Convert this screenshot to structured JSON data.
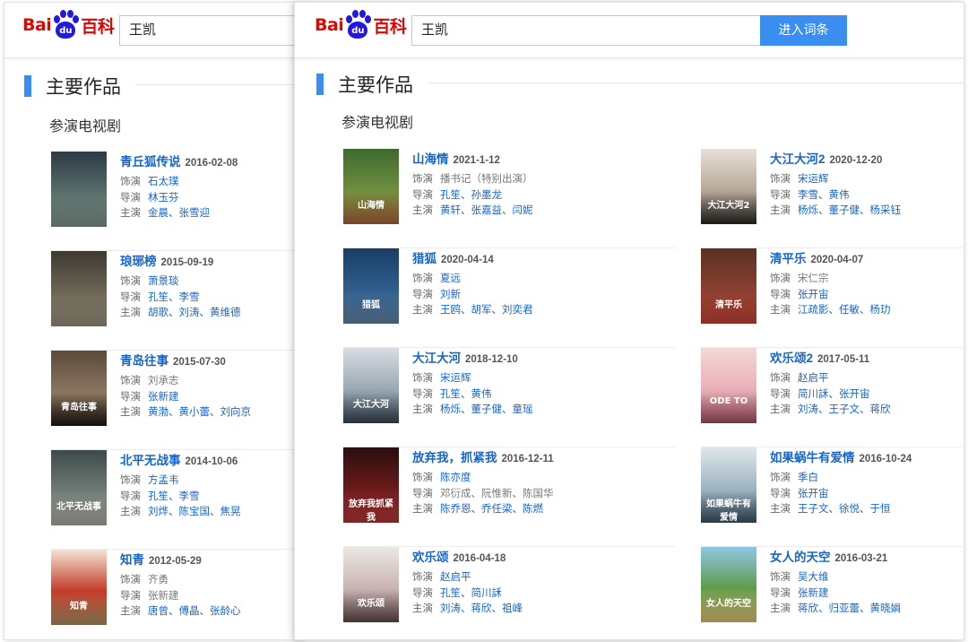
{
  "logo": {
    "bai": "Bai",
    "du": "du",
    "baike": "百科"
  },
  "left_panel": {
    "search_value": "王凯",
    "section_title": "主要作品",
    "sub_title": "参演电视剧",
    "items": [
      {
        "name": "青丘狐传说",
        "date": "2016-02-08",
        "role_label": "饰演",
        "role": "石太璞",
        "director_label": "导演",
        "director": "林玉芬",
        "cast_label": "主演",
        "cast": "金晨、张雪迎",
        "role_gray": false
      },
      {
        "name": "琅琊榜",
        "date": "2015-09-19",
        "role_label": "饰演",
        "role": "萧景琰",
        "director_label": "导演",
        "director": "孔笙、李雪",
        "cast_label": "主演",
        "cast": "胡歌、刘涛、黄维德",
        "role_gray": false
      },
      {
        "name": "青岛往事",
        "date": "2015-07-30",
        "role_label": "饰演",
        "role": "刘承志",
        "director_label": "导演",
        "director": "张新建",
        "cast_label": "主演",
        "cast": "黄渤、黄小蕾、刘向京",
        "role_gray": true
      },
      {
        "name": "北平无战事",
        "date": "2014-10-06",
        "role_label": "饰演",
        "role": "方孟韦",
        "director_label": "导演",
        "director": "孔笙、李雪",
        "cast_label": "主演",
        "cast": "刘烨、陈宝国、焦晃",
        "role_gray": false
      },
      {
        "name": "知青",
        "date": "2012-05-29",
        "role_label": "饰演",
        "role": "齐勇",
        "director_label": "导演",
        "director": "张新建",
        "cast_label": "主演",
        "cast": "唐曾、傅晶、张龄心",
        "role_gray": true,
        "director_gray": true
      }
    ]
  },
  "right_panel": {
    "search_value": "王凯",
    "search_button": "进入词条",
    "section_title": "主要作品",
    "sub_title": "参演电视剧",
    "items_left": [
      {
        "name": "山海情",
        "date": "2021-1-12",
        "role_label": "饰演",
        "role": "播书记（特别出演）",
        "director_label": "导演",
        "director": "孔笙、孙墨龙",
        "cast_label": "主演",
        "cast": "黄轩、张嘉益、闫妮",
        "role_gray": true
      },
      {
        "name": "猎狐",
        "date": "2020-04-14",
        "role_label": "饰演",
        "role": "夏远",
        "director_label": "导演",
        "director": "刘新",
        "cast_label": "主演",
        "cast": "王鸥、胡军、刘奕君",
        "role_gray": false
      },
      {
        "name": "大江大河",
        "date": "2018-12-10",
        "role_label": "饰演",
        "role": "宋运辉",
        "director_label": "导演",
        "director": "孔笙、黄伟",
        "cast_label": "主演",
        "cast": "杨烁、董子健、童瑶",
        "role_gray": false
      },
      {
        "name": "放弃我，抓紧我",
        "date": "2016-12-11",
        "role_label": "饰演",
        "role": "陈亦度",
        "director_label": "导演",
        "director": "邓衍成、阮惟新、陈国华",
        "cast_label": "主演",
        "cast": "陈乔恩、乔任梁、陈燃",
        "role_gray": false,
        "director_gray": true
      },
      {
        "name": "欢乐颂",
        "date": "2016-04-18",
        "role_label": "饰演",
        "role": "赵启平",
        "director_label": "导演",
        "director": "孔笙、简川訸",
        "cast_label": "主演",
        "cast": "刘涛、蒋欣、祖峰",
        "role_gray": false
      }
    ],
    "items_right": [
      {
        "name": "大江大河2",
        "date": "2020-12-20",
        "role_label": "饰演",
        "role": "宋运辉",
        "director_label": "导演",
        "director": "李雪、黄伟",
        "cast_label": "主演",
        "cast": "杨烁、董子健、杨采钰",
        "role_gray": false
      },
      {
        "name": "清平乐",
        "date": "2020-04-07",
        "role_label": "饰演",
        "role": "宋仁宗",
        "director_label": "导演",
        "director": "张开宙",
        "cast_label": "主演",
        "cast": "江疏影、任敏、杨玏",
        "role_gray": true
      },
      {
        "name": "欢乐颂2",
        "date": "2017-05-11",
        "role_label": "饰演",
        "role": "赵启平",
        "director_label": "导演",
        "director": "简川訸、张开宙",
        "cast_label": "主演",
        "cast": "刘涛、王子文、蒋欣",
        "role_gray": false
      },
      {
        "name": "如果蜗牛有爱情",
        "date": "2016-10-24",
        "role_label": "饰演",
        "role": "季白",
        "director_label": "导演",
        "director": "张开宙",
        "cast_label": "主演",
        "cast": "王子文、徐悦、于恒",
        "role_gray": false
      },
      {
        "name": "女人的天空",
        "date": "2016-03-21",
        "role_label": "饰演",
        "role": "吴大维",
        "director_label": "导演",
        "director": "张新建",
        "cast_label": "主演",
        "cast": "蒋欣、归亚蕾、黄晓娟",
        "role_gray": false
      }
    ]
  },
  "posters": {
    "l0": {
      "text": "",
      "colors": [
        "#2b3a44",
        "#5a6e6a",
        "#8a9e95"
      ]
    },
    "l1": {
      "text": "",
      "colors": [
        "#3e3a30",
        "#6d6656",
        "#a39b86"
      ]
    },
    "l2": {
      "text": "青岛往事",
      "colors": [
        "#5b4a3a",
        "#8a7560",
        "#1f1a16"
      ]
    },
    "l3": {
      "text": "北平无战事",
      "colors": [
        "#3c4a4a",
        "#6f7c76",
        "#b8b9ac"
      ]
    },
    "l4": {
      "text": "知青",
      "colors": [
        "#f4e4d0",
        "#c23a2a",
        "#b89a6a"
      ]
    },
    "r0": {
      "text": "山海情",
      "colors": [
        "#3d6a2e",
        "#6f8e3e",
        "#b56b3e"
      ]
    },
    "r1": {
      "text": "猎狐",
      "colors": [
        "#1a3d66",
        "#2f5e8c",
        "#6a8eb0"
      ]
    },
    "r2": {
      "text": "大江大河",
      "colors": [
        "#d8dde2",
        "#9aa8b5",
        "#3c4a5a"
      ]
    },
    "r3": {
      "text": "放弃我抓紧我",
      "colors": [
        "#2a0e0e",
        "#6a1a1a",
        "#c43a3a"
      ]
    },
    "r4": {
      "text": "欢乐颂",
      "colors": [
        "#ece8e4",
        "#c9b3b3",
        "#6a5050"
      ]
    },
    "r5": {
      "text": "大江大河2",
      "colors": [
        "#e8e0d8",
        "#b7a898",
        "#2e2a28"
      ]
    },
    "r6": {
      "text": "清平乐",
      "colors": [
        "#5a3022",
        "#8a4030",
        "#d04a3a"
      ]
    },
    "r7": {
      "text": "ODE TO",
      "colors": [
        "#f4d8d4",
        "#e8b0b8",
        "#b0586a"
      ]
    },
    "r8": {
      "text": "如果蜗牛有爱情",
      "colors": [
        "#dfe6ea",
        "#9eb4c2",
        "#3e5a6a"
      ]
    },
    "r9": {
      "text": "女人的天空",
      "colors": [
        "#8fc7e4",
        "#5f9a4a",
        "#f0d27a"
      ]
    }
  },
  "colors": {
    "accent": "#3b8ef0",
    "link": "#1765c9",
    "brand_red": "#e10601",
    "brand_blue": "#2319dc"
  }
}
